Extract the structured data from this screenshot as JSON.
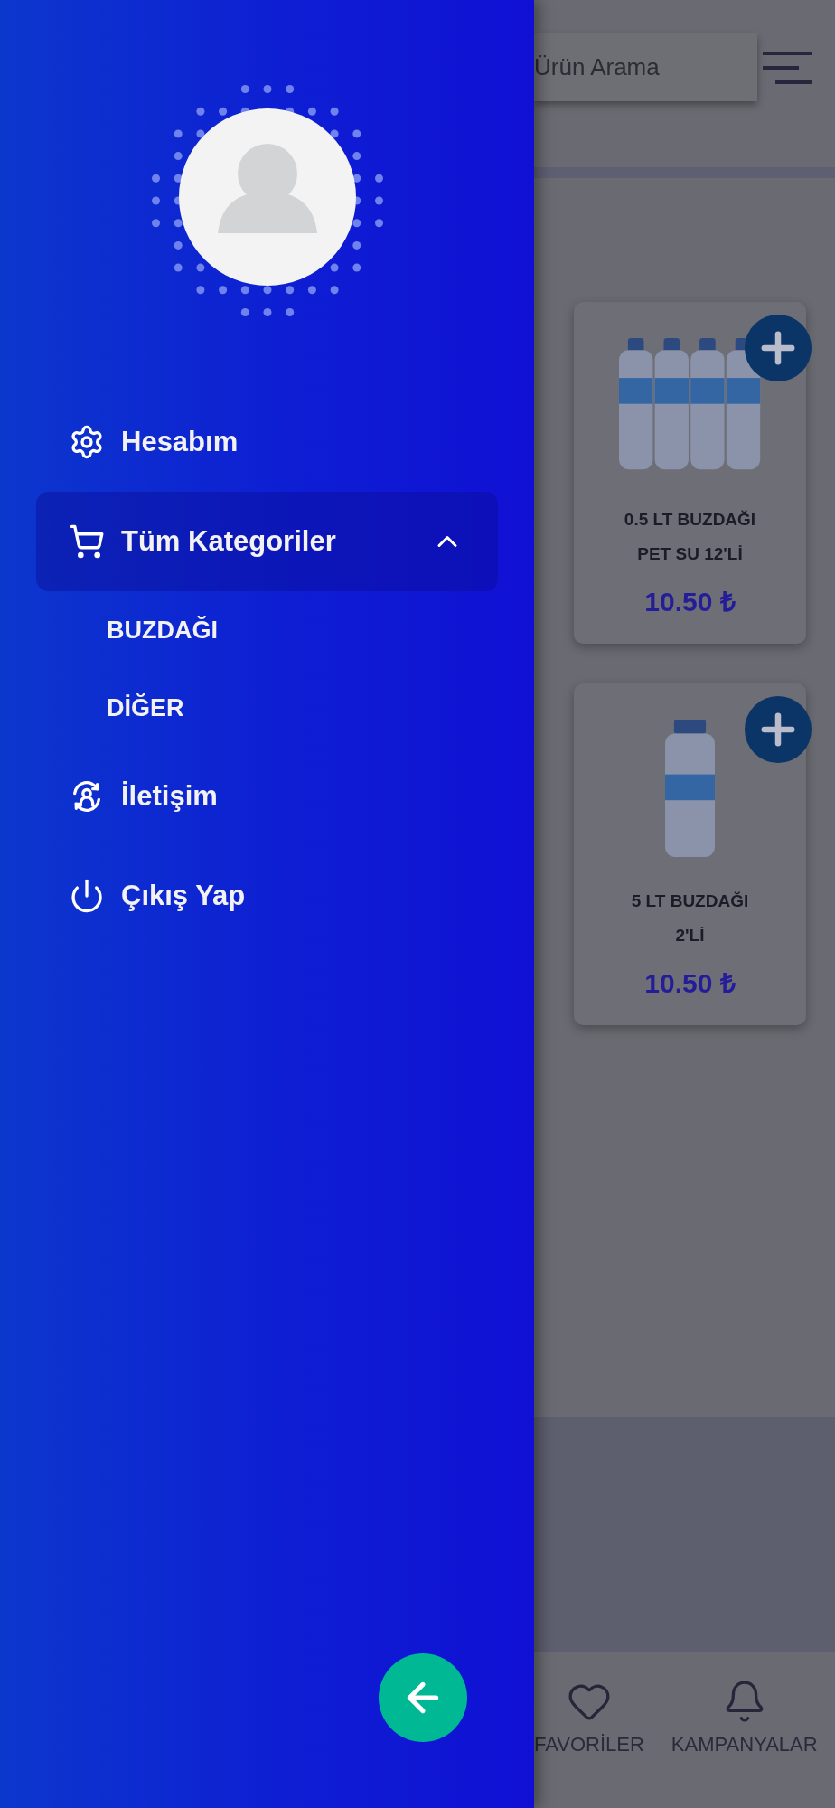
{
  "drawer": {
    "menu": [
      {
        "kind": "account",
        "label": "Hesabım",
        "selected": false
      },
      {
        "kind": "categories",
        "label": "Tüm Kategoriler",
        "selected": true,
        "expanded": true,
        "children": [
          {
            "label": "BUZDAĞI"
          },
          {
            "label": "DİĞER"
          }
        ]
      },
      {
        "kind": "contact",
        "label": "İletişim",
        "selected": false
      },
      {
        "kind": "logout",
        "label": "Çıkış Yap",
        "selected": false
      }
    ]
  },
  "search": {
    "placeholder": "Ürün Arama"
  },
  "products": [
    {
      "name": "0.5 LT BUZDAĞI\nPET SU 12'Lİ",
      "price": "10.50 ₺"
    },
    {
      "name": "5 LT BUZDAĞI\n2'Lİ",
      "price": "10.50 ₺"
    }
  ],
  "bottom_nav": [
    {
      "kind": "favorites",
      "label": "FAVORİLER"
    },
    {
      "kind": "campaigns",
      "label": "KAMPANYALAR"
    }
  ]
}
